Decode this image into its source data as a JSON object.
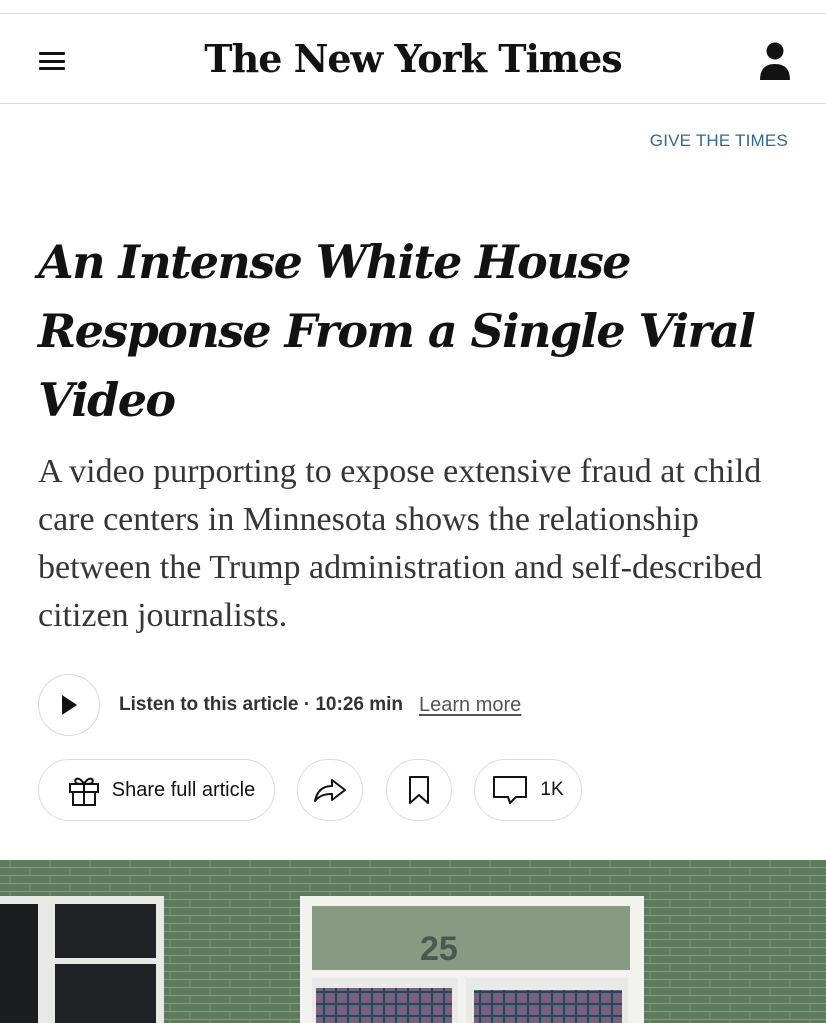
{
  "masthead": {
    "logo_text": "The New York Times",
    "menu_icon": "hamburger-menu-icon",
    "account_icon": "user-account-icon"
  },
  "promo": {
    "give_link": "GIVE THE TIMES"
  },
  "article": {
    "headline_lines": [
      "An Intense White House",
      "Response From a Single Viral",
      "Video"
    ],
    "summary": "A video purporting to expose extensive fraud at child care centers in Minnesota shows the relationship between the Trump administration and self-described citizen journalists."
  },
  "audio": {
    "play_icon": "play-icon",
    "listen_label": "Listen to this article · 10:26 min",
    "learn_more": "Learn more"
  },
  "actions": {
    "share_full_label": "Share full article",
    "gift_icon": "gift-icon",
    "share_icon": "share-arrow-icon",
    "bookmark_icon": "bookmark-icon",
    "comment_icon": "comment-icon",
    "comments_count": "1K"
  },
  "hero_image": {
    "number_on_door": "25"
  },
  "colors": {
    "link_blue": "#326891",
    "text": "#121212",
    "summary_text": "#363636",
    "wall_green": "#5f7a5d"
  }
}
